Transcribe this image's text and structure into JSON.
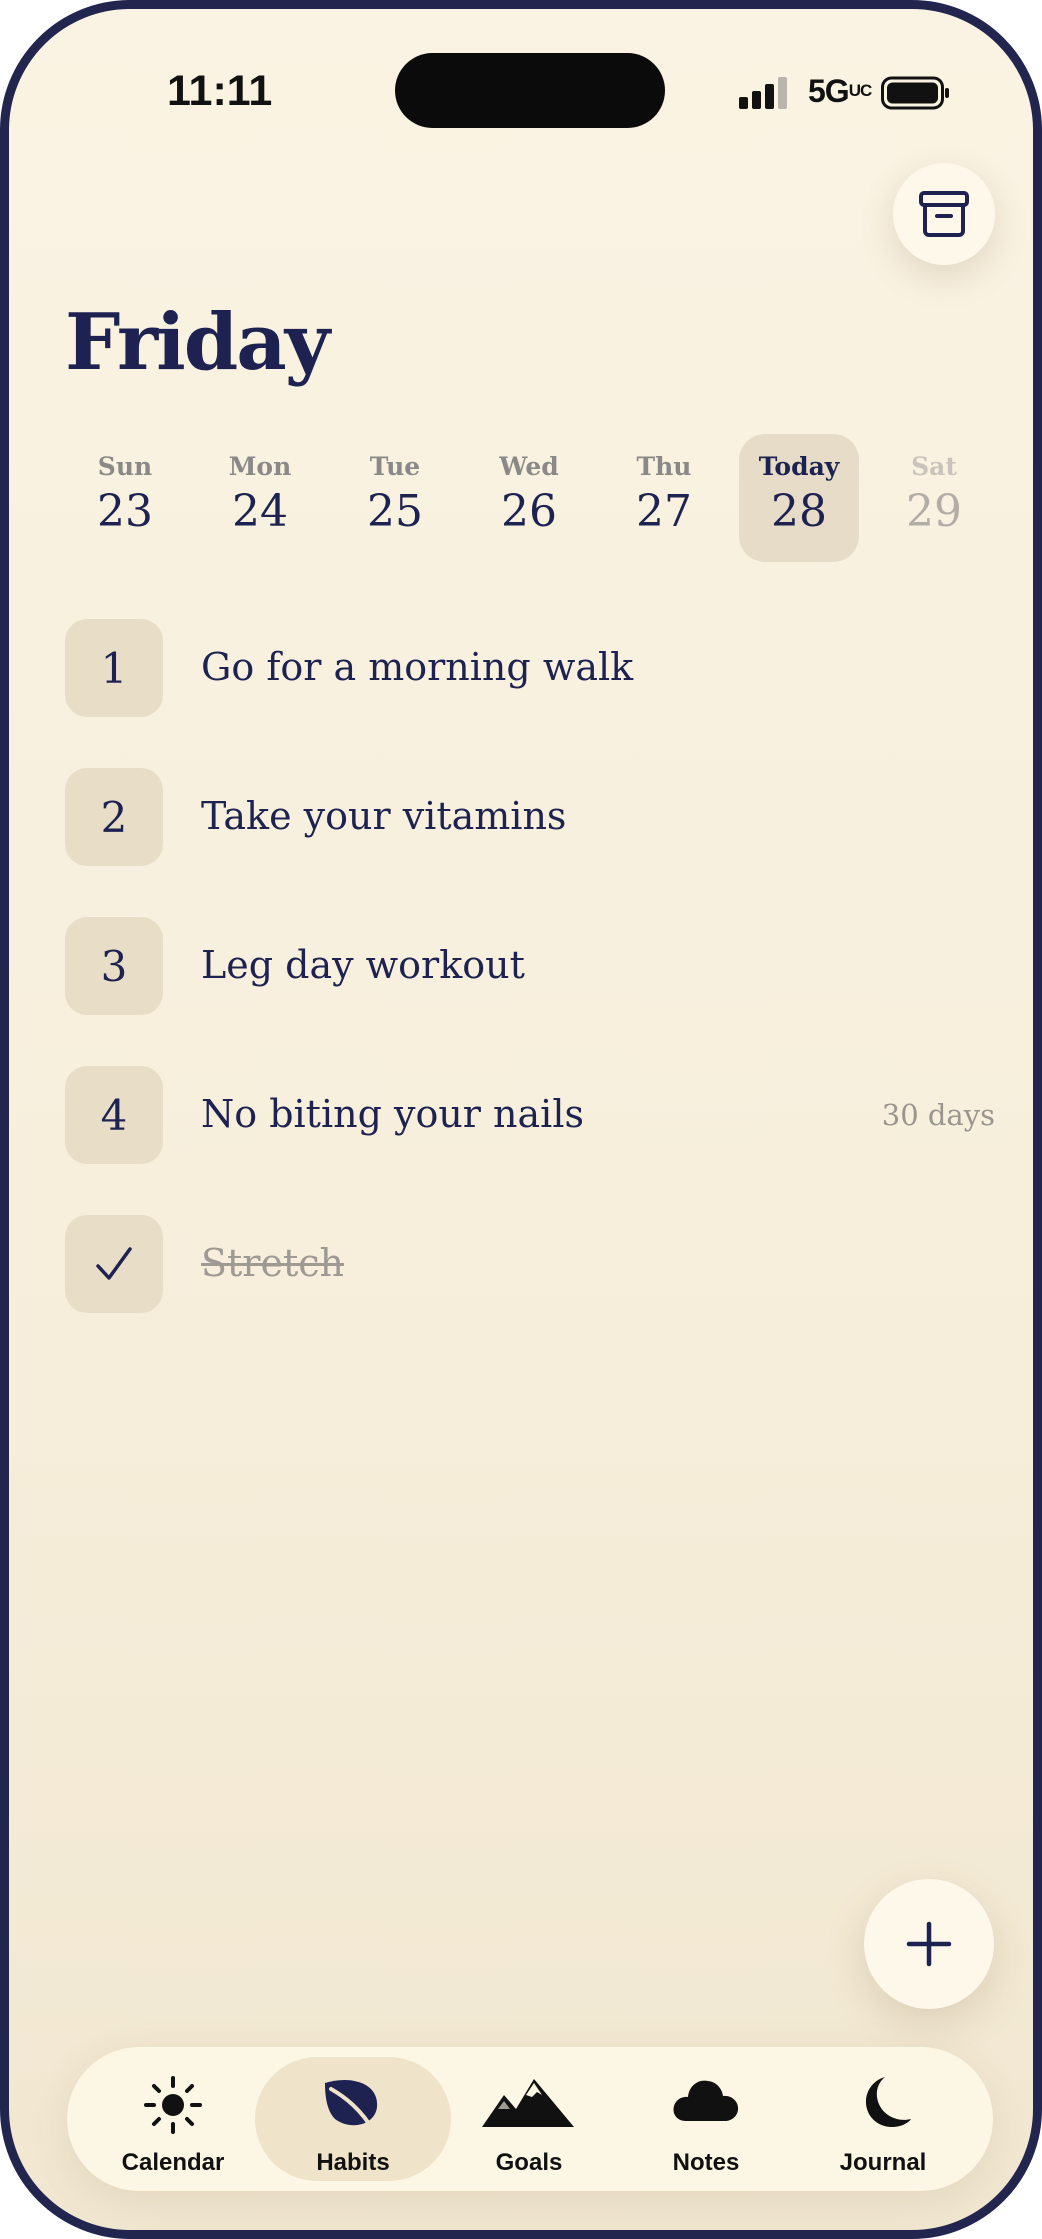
{
  "status_bar": {
    "time": "11:11",
    "network": "5G",
    "network_suffix": "UC"
  },
  "header": {
    "title": "Friday",
    "archive_icon": "archive-box-icon"
  },
  "week": [
    {
      "name": "Sun",
      "date": "23",
      "state": "past"
    },
    {
      "name": "Mon",
      "date": "24",
      "state": "past"
    },
    {
      "name": "Tue",
      "date": "25",
      "state": "past"
    },
    {
      "name": "Wed",
      "date": "26",
      "state": "past"
    },
    {
      "name": "Thu",
      "date": "27",
      "state": "past"
    },
    {
      "name": "Today",
      "date": "28",
      "state": "today"
    },
    {
      "name": "Sat",
      "date": "29",
      "state": "future"
    }
  ],
  "habits": [
    {
      "index": "1",
      "label": "Go for a morning walk",
      "streak": "",
      "done": false
    },
    {
      "index": "2",
      "label": "Take your vitamins",
      "streak": "",
      "done": false
    },
    {
      "index": "3",
      "label": "Leg day workout",
      "streak": "",
      "done": false
    },
    {
      "index": "4",
      "label": "No biting your nails",
      "streak": "30 days",
      "done": false
    },
    {
      "index": "✓",
      "label": "Stretch",
      "streak": "",
      "done": true
    }
  ],
  "fab": {
    "icon": "plus-icon"
  },
  "tabs": [
    {
      "label": "Calendar",
      "icon": "sun-icon",
      "active": false
    },
    {
      "label": "Habits",
      "icon": "leaf-icon",
      "active": true
    },
    {
      "label": "Goals",
      "icon": "mountains-icon",
      "active": false
    },
    {
      "label": "Notes",
      "icon": "cloud-icon",
      "active": false
    },
    {
      "label": "Journal",
      "icon": "moon-icon",
      "active": false
    }
  ],
  "colors": {
    "ink": "#1d2250",
    "background": "#faf3e3",
    "chip": "#e8dec8",
    "frame": "#22264f"
  }
}
